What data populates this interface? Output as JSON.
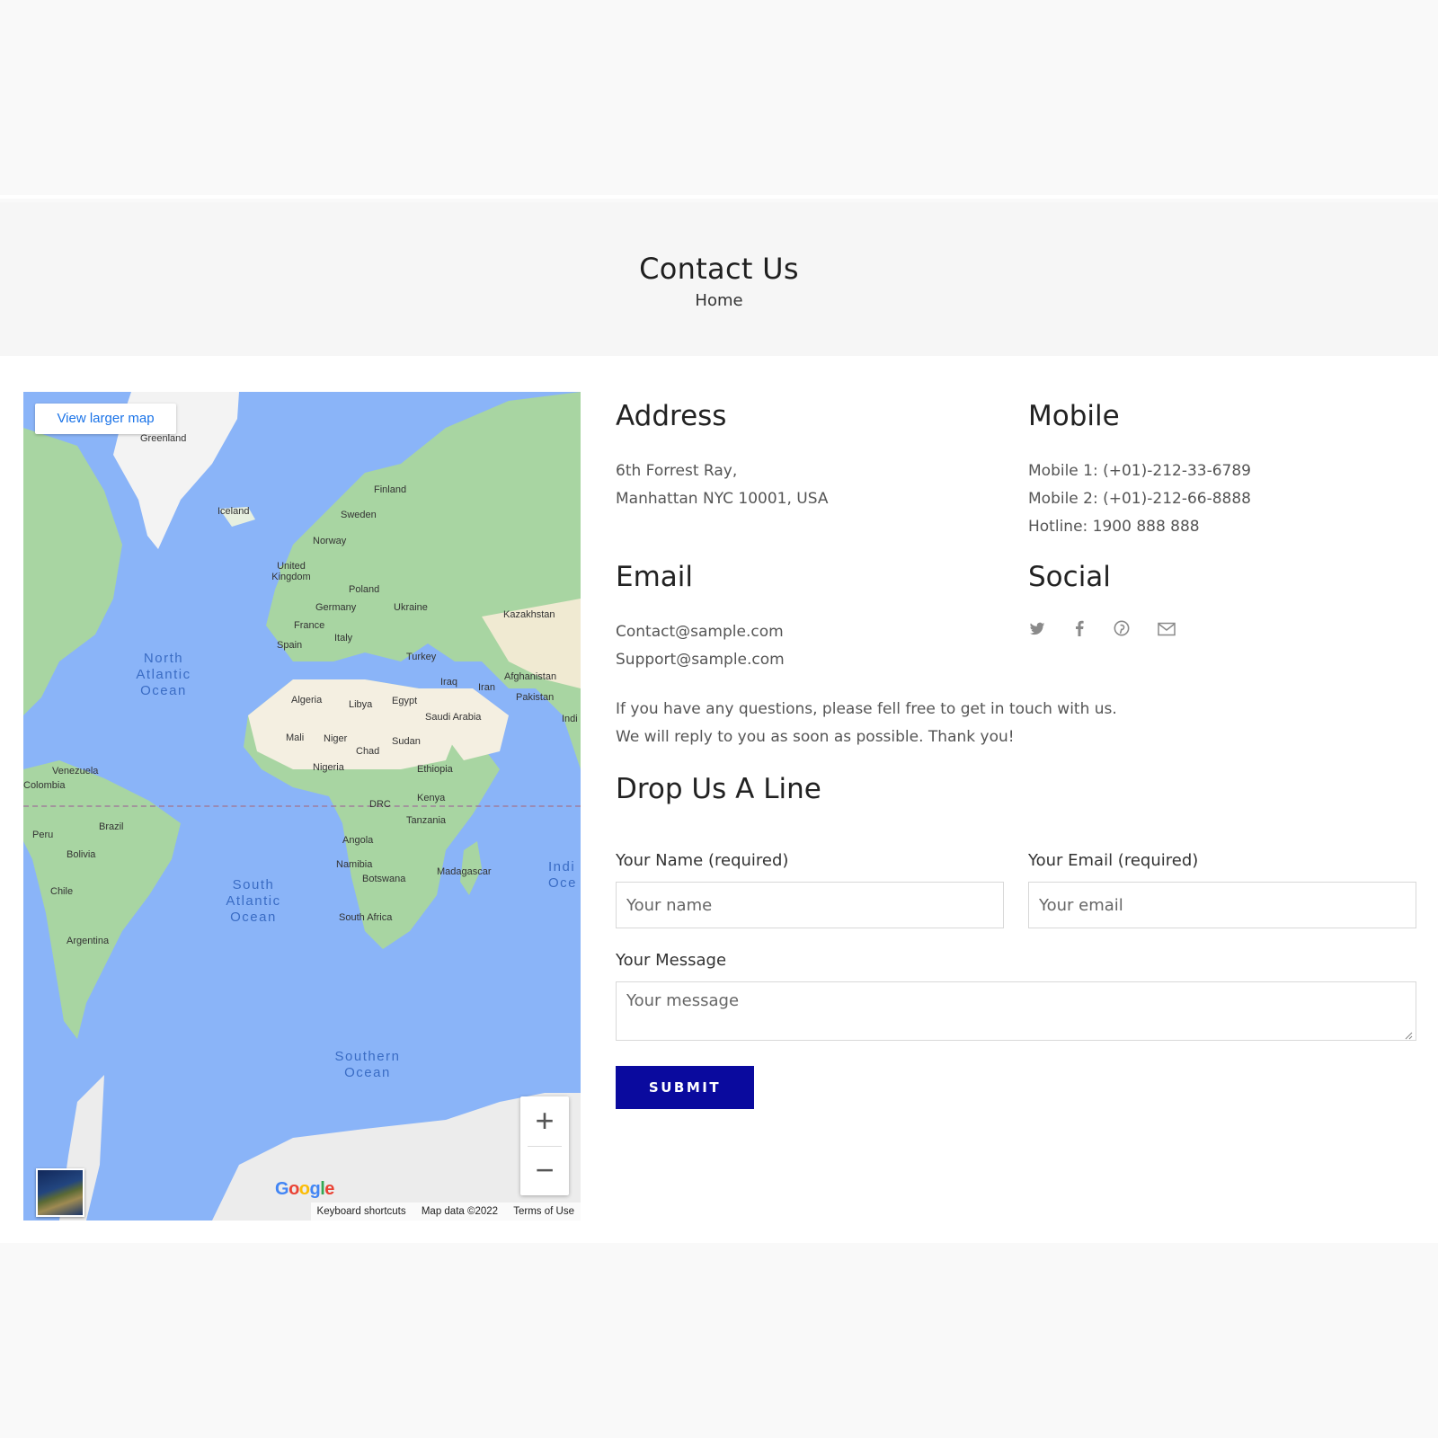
{
  "page_header": {
    "title": "Contact Us",
    "breadcrumb": "Home"
  },
  "map": {
    "view_larger_label": "View larger map",
    "zoom_in": "+",
    "zoom_out": "−",
    "google_logo": "Google",
    "footer": {
      "keyboard_shortcuts": "Keyboard shortcuts",
      "map_data": "Map data ©2022",
      "terms": "Terms of Use"
    },
    "places": [
      "Greenland",
      "Iceland",
      "Finland",
      "Sweden",
      "Norway",
      "United Kingdom",
      "Poland",
      "Germany",
      "Ukraine",
      "France",
      "Kazakhstan",
      "Italy",
      "Spain",
      "Turkey",
      "Iraq",
      "Iran",
      "Afghanistan",
      "Pakistan",
      "Algeria",
      "Libya",
      "Egypt",
      "Saudi Arabia",
      "Mali",
      "Niger",
      "Chad",
      "Sudan",
      "Nigeria",
      "Ethiopia",
      "Venezuela",
      "Colombia",
      "DRC",
      "Kenya",
      "Tanzania",
      "Brazil",
      "Peru",
      "Bolivia",
      "Angola",
      "Namibia",
      "Botswana",
      "Madagascar",
      "Chile",
      "South Africa",
      "Argentina",
      "Indi"
    ],
    "oceans": [
      "North Atlantic Ocean",
      "South Atlantic Ocean",
      "Southern Ocean",
      "Indi Oce"
    ]
  },
  "address": {
    "heading": "Address",
    "line1": "6th Forrest Ray,",
    "line2": "Manhattan NYC 10001, USA"
  },
  "mobile": {
    "heading": "Mobile",
    "line1": "Mobile 1: (+01)-212-33-6789",
    "line2": "Mobile 2: (+01)-212-66-8888",
    "line3": "Hotline: 1900 888 888"
  },
  "email": {
    "heading": "Email",
    "line1": "Contact@sample.com",
    "line2": "Support@sample.com"
  },
  "social": {
    "heading": "Social",
    "icons": [
      "twitter-icon",
      "facebook-icon",
      "pinterest-icon",
      "mail-icon"
    ]
  },
  "intro": {
    "line1": "If you have any questions, please fell free to get in touch with us.",
    "line2": "We will reply to you as soon as possible. Thank you!"
  },
  "form": {
    "heading": "Drop Us A Line",
    "name_label": "Your Name (required)",
    "name_placeholder": "Your name",
    "email_label": "Your Email (required)",
    "email_placeholder": "Your email",
    "message_label": "Your Message",
    "message_placeholder": "Your message",
    "submit_label": "SUBMIT"
  },
  "colors": {
    "submit_bg": "#0a0a9e",
    "map_water": "#8ab4f8",
    "map_link": "#1a73e8"
  }
}
